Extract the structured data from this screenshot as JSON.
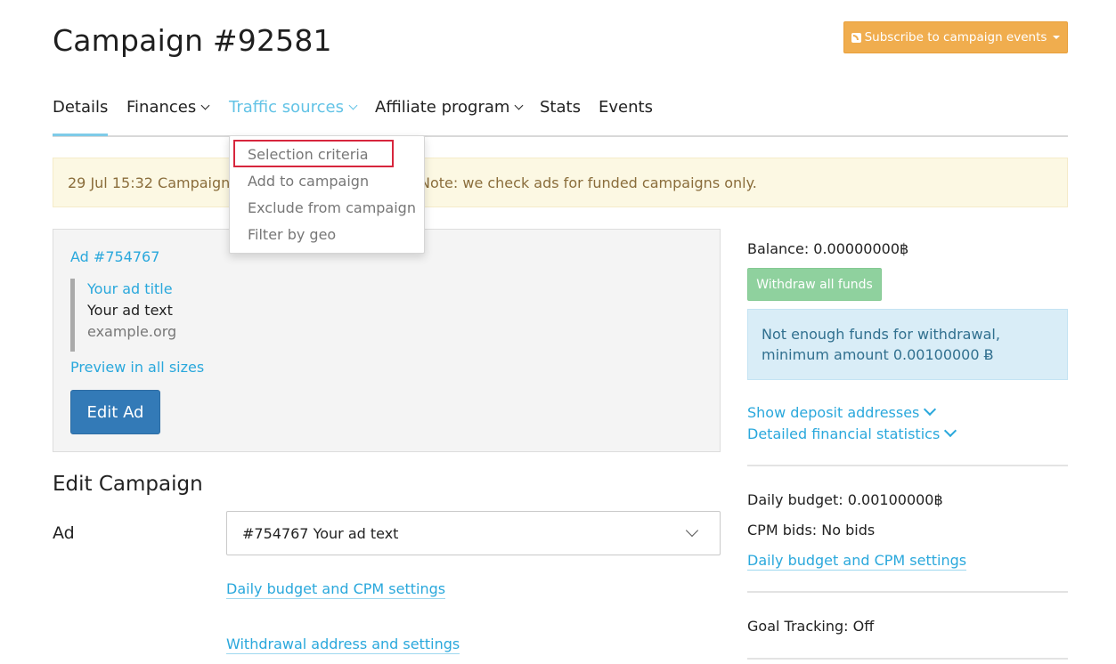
{
  "header": {
    "title": "Campaign #92581",
    "subscribe_label": "Subscribe to campaign events"
  },
  "nav": {
    "tabs": [
      {
        "label": "Details",
        "active": true
      },
      {
        "label": "Finances",
        "dropdown": true
      },
      {
        "label": "Traffic sources",
        "dropdown": true,
        "open": true
      },
      {
        "label": "Affiliate program",
        "dropdown": true
      },
      {
        "label": "Stats"
      },
      {
        "label": "Events"
      }
    ]
  },
  "dropdown": {
    "items": [
      "Selection criteria",
      "Add to campaign",
      "Exclude from campaign",
      "Filter by geo"
    ]
  },
  "alert": {
    "left_text": "29 Jul 15:32 Campaign ad",
    "right_text": "Note: we check ads for funded campaigns only."
  },
  "ad": {
    "id_label": "Ad #754767",
    "title": "Your ad title",
    "text": "Your ad text",
    "domain": "example.org",
    "preview_label": "Preview in all sizes",
    "edit_label": "Edit Ad"
  },
  "edit_campaign": {
    "heading": "Edit Campaign",
    "ad_label": "Ad",
    "ad_select_value": "#754767 Your ad text",
    "budget_link": "Daily budget and CPM settings",
    "withdrawal_link": "Withdrawal address and settings"
  },
  "finance": {
    "balance": "Balance: 0.00000000฿",
    "withdraw_label": "Withdraw all funds",
    "info_line1": "Not enough funds for withdrawal,",
    "info_line2": "minimum amount 0.00100000 Ƀ",
    "show_deposit": "Show deposit addresses",
    "detailed_stats": "Detailed financial statistics",
    "daily_budget": "Daily budget: 0.00100000฿",
    "cpm_bids": "CPM bids: No bids",
    "budget_link": "Daily budget and CPM settings",
    "goal_tracking": "Goal Tracking: Off"
  },
  "colors": {
    "link": "#2aa8dc",
    "subscribe_bg": "#f0ad4e",
    "edit_btn_bg": "#337ab7",
    "withdraw_bg": "#8fd19e",
    "alert_bg": "#fcf8e3",
    "info_bg": "#d9edf7",
    "highlight_border": "#d7263d"
  }
}
